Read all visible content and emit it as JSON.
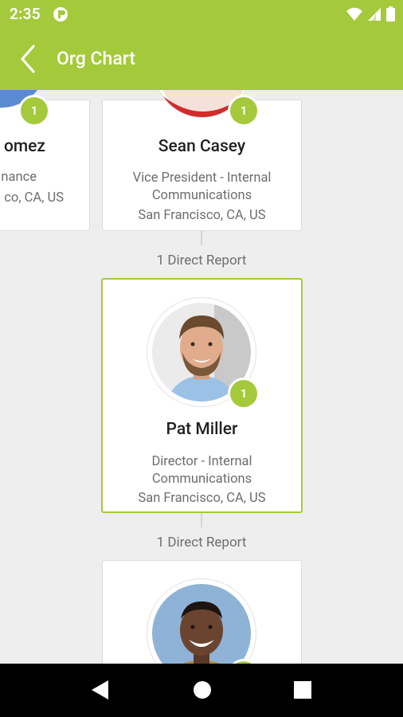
{
  "status_bar": {
    "time": "2:35"
  },
  "app_bar": {
    "title": "Org Chart"
  },
  "manager_cards": [
    {
      "name": "omez",
      "title_lines": [
        "nance"
      ],
      "location": "co, CA, US",
      "badge": "1"
    },
    {
      "name": "Sean Casey",
      "title_lines": [
        "Vice President - Internal",
        "Communications"
      ],
      "location": "San Francisco, CA, US",
      "badge": "1"
    }
  ],
  "direct_report_label_1": "1 Direct Report",
  "selected_employee": {
    "name": "Pat Miller",
    "title_lines": [
      "Director - Internal",
      "Communications"
    ],
    "location": "San Francisco, CA, US",
    "badge": "1"
  },
  "direct_report_label_2": "1 Direct Report",
  "colors": {
    "accent": "#a4c93b",
    "background": "#eeeeee",
    "nav": "#000000"
  }
}
